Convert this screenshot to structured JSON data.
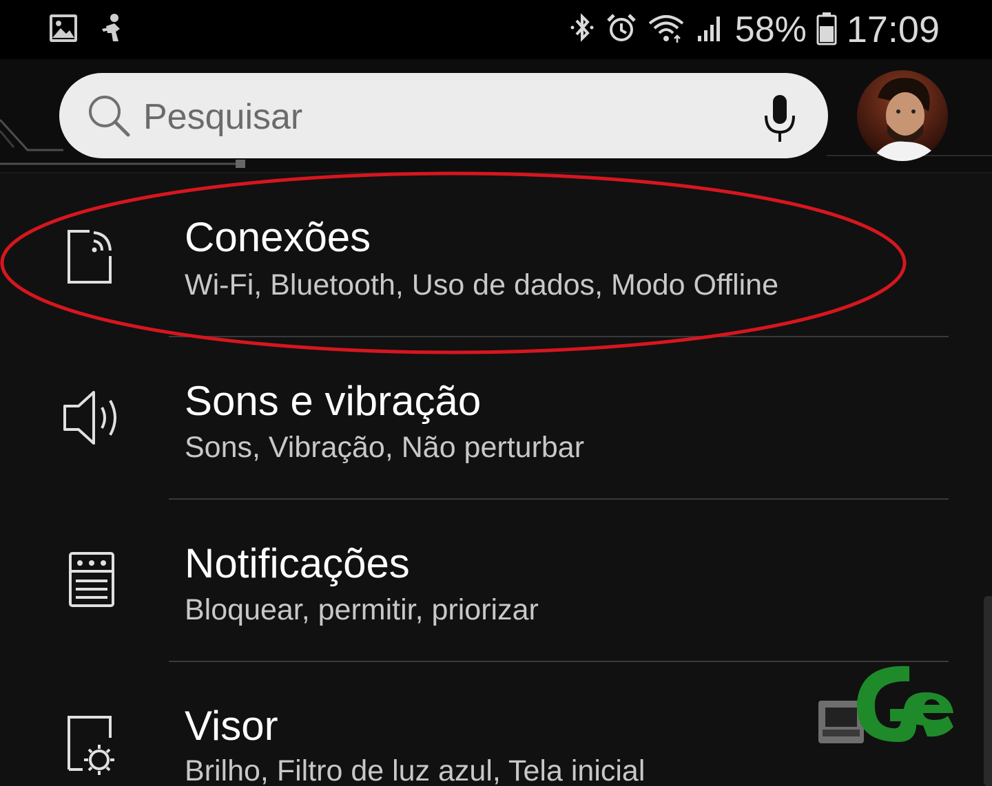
{
  "status_bar": {
    "battery_percent": "58%",
    "time": "17:09",
    "left_icons": [
      "image-icon",
      "figure-icon"
    ],
    "right_icons": [
      "bluetooth-icon",
      "alarm-icon",
      "wifi-icon",
      "signal-icon",
      "battery-icon"
    ]
  },
  "search": {
    "placeholder": "Pesquisar"
  },
  "settings": {
    "items": [
      {
        "title": "Conexões",
        "subtitle": "Wi-Fi, Bluetooth, Uso de dados, Modo Offline",
        "icon": "connections-icon"
      },
      {
        "title": "Sons e vibração",
        "subtitle": "Sons, Vibração, Não perturbar",
        "icon": "speaker-icon"
      },
      {
        "title": "Notificações",
        "subtitle": "Bloquear, permitir, priorizar",
        "icon": "notifications-icon"
      },
      {
        "title": "Visor",
        "subtitle": "Brilho, Filtro de luz azul, Tela inicial",
        "icon": "display-icon"
      }
    ]
  },
  "colors": {
    "background": "#111111",
    "highlight": "#d7161e",
    "watermark": "#1f8a2a"
  }
}
